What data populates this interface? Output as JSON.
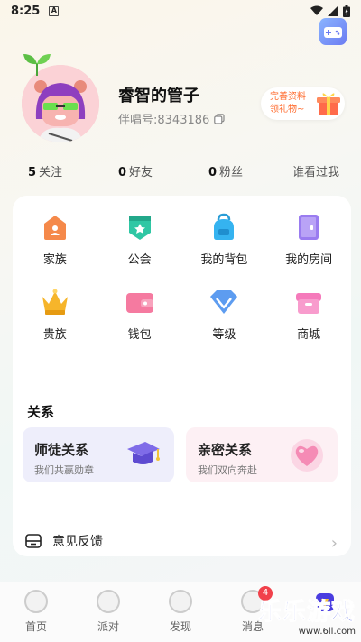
{
  "status": {
    "time": "8:25",
    "a_glyph": "A"
  },
  "profile": {
    "nickname": "睿智的管子",
    "uid": "伴唱号:8343186"
  },
  "gift_button": {
    "line1": "完善资料",
    "line2": "领礼物~"
  },
  "stats": [
    {
      "count": "5",
      "label": "关注"
    },
    {
      "count": "0",
      "label": "好友"
    },
    {
      "count": "0",
      "label": "粉丝"
    },
    {
      "count": "",
      "label": "谁看过我"
    }
  ],
  "grid": [
    {
      "label": "家族",
      "icon": "family-icon",
      "color": "#f5894a"
    },
    {
      "label": "公会",
      "icon": "guild-icon",
      "color": "#2fc7a4"
    },
    {
      "label": "我的背包",
      "icon": "backpack-icon",
      "color": "#35b3f0"
    },
    {
      "label": "我的房间",
      "icon": "room-icon",
      "color": "#9a7cf0"
    },
    {
      "label": "贵族",
      "icon": "crown-icon",
      "color": "#f6b52b"
    },
    {
      "label": "钱包",
      "icon": "wallet-icon",
      "color": "#f57aa0"
    },
    {
      "label": "等级",
      "icon": "diamond-icon",
      "color": "#5d9cf0"
    },
    {
      "label": "商城",
      "icon": "shop-icon",
      "color": "#f57abb"
    }
  ],
  "relations": {
    "title": "关系",
    "mentor": {
      "title": "师徒关系",
      "subtitle": "我们共赢勋章"
    },
    "intimate": {
      "title": "亲密关系",
      "subtitle": "我们双向奔赴"
    }
  },
  "feedback": {
    "label": "意见反馈"
  },
  "tabs": [
    {
      "label": "首页"
    },
    {
      "label": "派对"
    },
    {
      "label": "发现"
    },
    {
      "label": "消息",
      "badge": "4"
    },
    {
      "label": ""
    }
  ],
  "watermark": {
    "main": "乐乐游戏",
    "url": "www.6ll.com"
  }
}
